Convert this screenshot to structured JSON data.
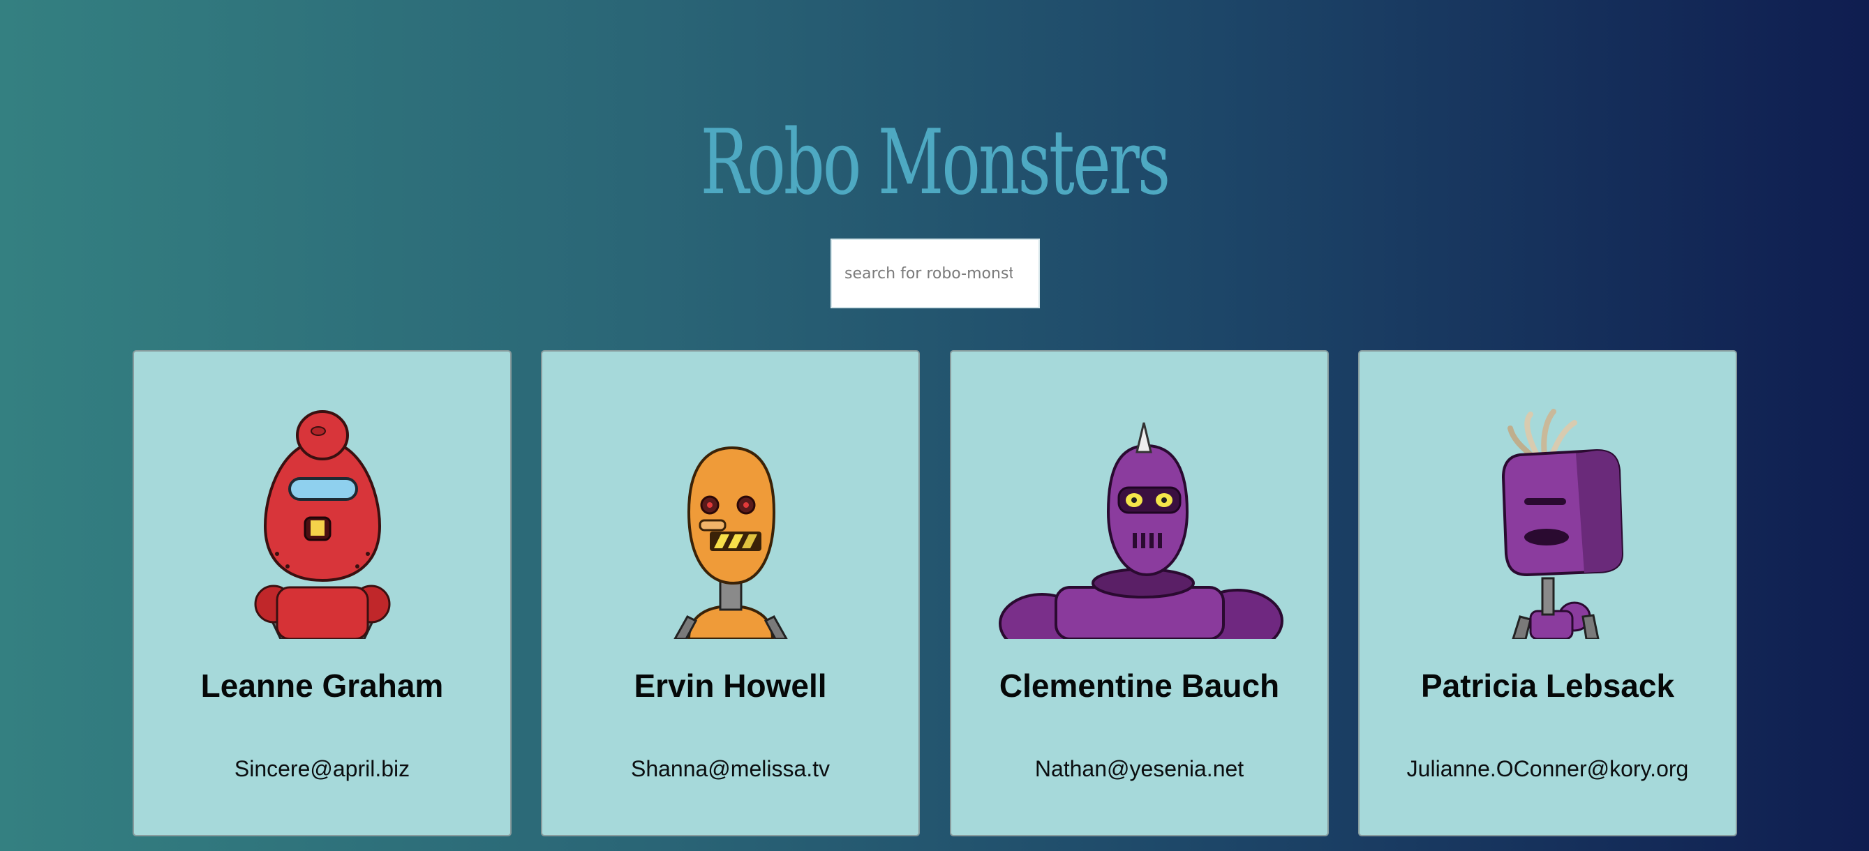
{
  "header": {
    "title": "Robo Monsters"
  },
  "search": {
    "placeholder": "search for robo-monst"
  },
  "cards": [
    {
      "name": "Leanne Graham",
      "email": "Sincere@april.biz",
      "icon": "red-robot-avatar"
    },
    {
      "name": "Ervin Howell",
      "email": "Shanna@melissa.tv",
      "icon": "orange-robot-avatar"
    },
    {
      "name": "Clementine Bauch",
      "email": "Nathan@yesenia.net",
      "icon": "purple-horned-robot-avatar"
    },
    {
      "name": "Patricia Lebsack",
      "email": "Julianne.OConner@kory.org",
      "icon": "purple-box-robot-avatar"
    }
  ],
  "colors": {
    "title": "#4ea9c2",
    "card_background": "#a6d9da",
    "gradient_start": "#348081",
    "gradient_end": "#0f1d50"
  }
}
